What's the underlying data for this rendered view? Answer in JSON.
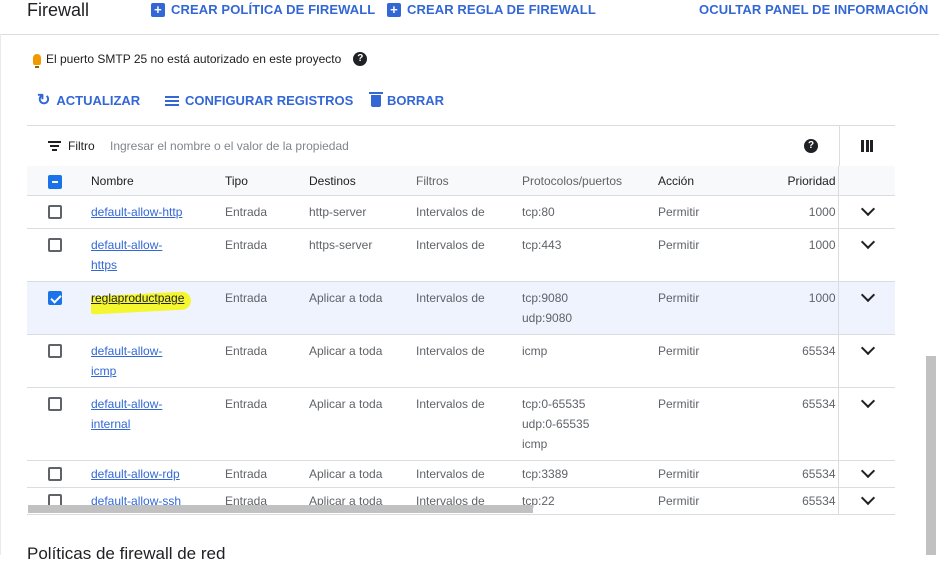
{
  "header": {
    "title": "Firewall",
    "create_policy": "CREAR POLÍTICA DE FIREWALL",
    "create_rule": "CREAR REGLA DE FIREWALL",
    "hide_panel": "OCULTAR PANEL DE INFORMACIÓN"
  },
  "notice": {
    "text": "El puerto SMTP 25 no está autorizado en este proyecto"
  },
  "actions": {
    "refresh": "ACTUALIZAR",
    "config_logs": "CONFIGURAR REGISTROS",
    "delete": "BORRAR"
  },
  "filter": {
    "label": "Filtro",
    "placeholder": "Ingresar el nombre o el valor de la propiedad"
  },
  "table": {
    "headers": {
      "name": "Nombre",
      "type": "Tipo",
      "targets": "Destinos",
      "filters": "Filtros",
      "protocols": "Protocolos/puertos",
      "action": "Acción",
      "priority": "Prioridad"
    },
    "rows": [
      {
        "name": "default-allow-http",
        "type": "Entrada",
        "targets": "http-server",
        "filters": "Intervalos de",
        "protocols": [
          "tcp:80"
        ],
        "action": "Permitir",
        "priority": "1000",
        "checked": false
      },
      {
        "name": "default-allow-https",
        "type": "Entrada",
        "targets": "https-server",
        "filters": "Intervalos de",
        "protocols": [
          "tcp:443"
        ],
        "action": "Permitir",
        "priority": "1000",
        "checked": false
      },
      {
        "name": "reglaproductpage",
        "type": "Entrada",
        "targets": "Aplicar a toda",
        "filters": "Intervalos de",
        "protocols": [
          "tcp:9080",
          "udp:9080"
        ],
        "action": "Permitir",
        "priority": "1000",
        "checked": true
      },
      {
        "name": "default-allow-icmp",
        "type": "Entrada",
        "targets": "Aplicar a toda",
        "filters": "Intervalos de",
        "protocols": [
          "icmp"
        ],
        "action": "Permitir",
        "priority": "65534",
        "checked": false
      },
      {
        "name": "default-allow-internal",
        "type": "Entrada",
        "targets": "Aplicar a toda",
        "filters": "Intervalos de",
        "protocols": [
          "tcp:0-65535",
          "udp:0-65535",
          "icmp"
        ],
        "action": "Permitir",
        "priority": "65534",
        "checked": false
      },
      {
        "name": "default-allow-rdp",
        "type": "Entrada",
        "targets": "Aplicar a toda",
        "filters": "Intervalos de",
        "protocols": [
          "tcp:3389"
        ],
        "action": "Permitir",
        "priority": "65534",
        "checked": false
      },
      {
        "name": "default-allow-ssh",
        "type": "Entrada",
        "targets": "Aplicar a toda",
        "filters": "Intervalos de",
        "protocols": [
          "tcp:22"
        ],
        "action": "Permitir",
        "priority": "65534",
        "checked": false
      }
    ]
  },
  "section": {
    "title": "Políticas de firewall de red"
  },
  "colors": {
    "accent": "#3367d6",
    "highlight": "#f4f70b",
    "selected_row": "#eef3fd"
  },
  "icons": [
    "plus-icon",
    "bulb-icon",
    "help-icon",
    "refresh-icon",
    "lines-icon",
    "trash-icon",
    "filter-icon",
    "columns-icon",
    "chevron-down-icon"
  ]
}
